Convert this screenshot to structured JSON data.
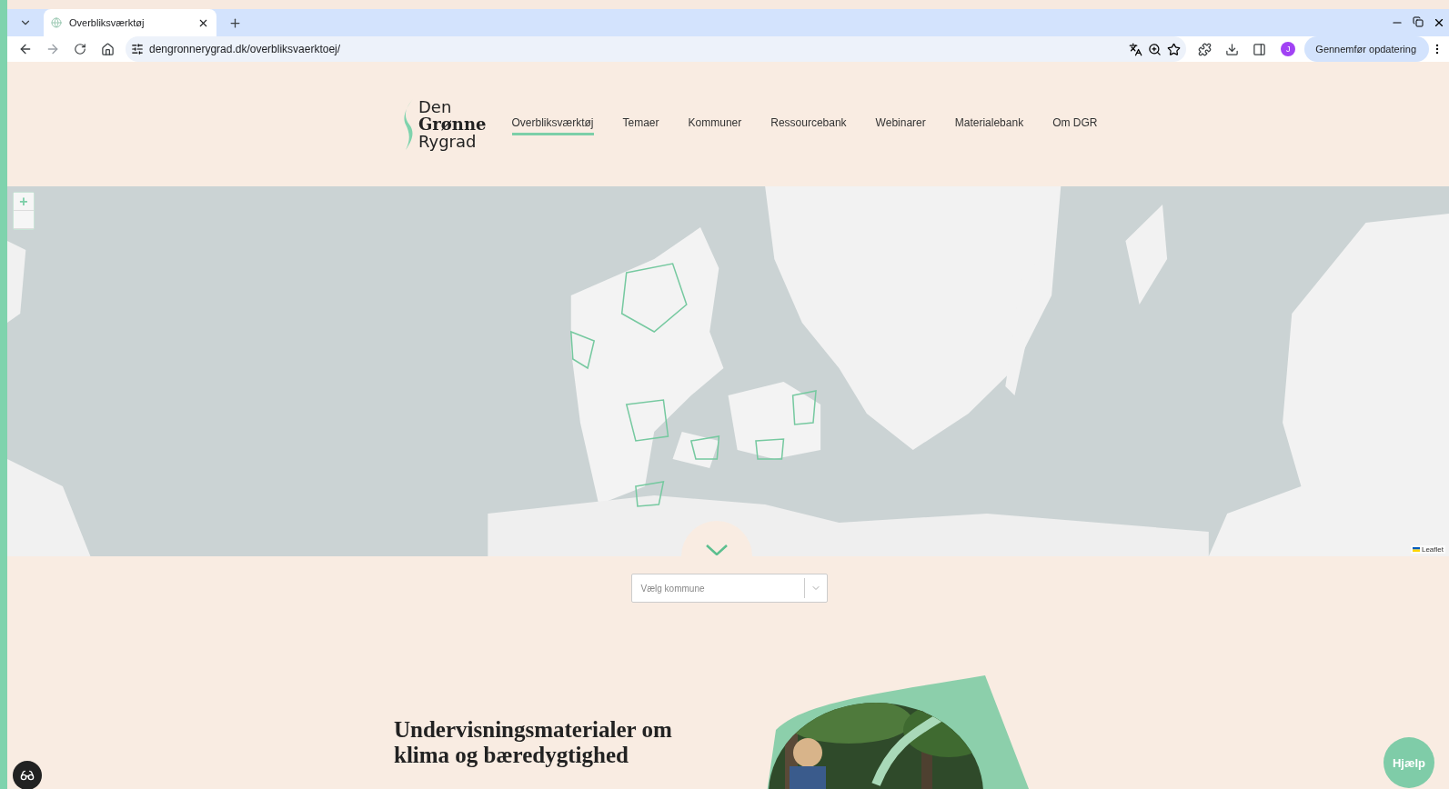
{
  "browser": {
    "tab": {
      "title": "Overbliksværktøj",
      "selected": true
    },
    "url": "dengronnerygrad.dk/overbliksvaerktoej/",
    "profile_initial": "J",
    "update_button": "Gennemfør opdatering"
  },
  "site": {
    "logo": [
      "Den",
      "Grønne",
      "Rygrad"
    ],
    "nav": [
      {
        "label": "Overbliksværktøj",
        "selected": true
      },
      {
        "label": "Temaer",
        "selected": false
      },
      {
        "label": "Kommuner",
        "selected": false
      },
      {
        "label": "Ressourcebank",
        "selected": false
      },
      {
        "label": "Webinarer",
        "selected": false
      },
      {
        "label": "Materialebank",
        "selected": false
      },
      {
        "label": "Om DGR",
        "selected": false
      }
    ]
  },
  "map": {
    "zoom_in": "+",
    "attribution": "Leaflet"
  },
  "municipality_select": {
    "placeholder": "Vælg kommune"
  },
  "section": {
    "heading": "Undervisningsmaterialer om klima og bæredygtighed"
  },
  "help_button": "Hjælp"
}
